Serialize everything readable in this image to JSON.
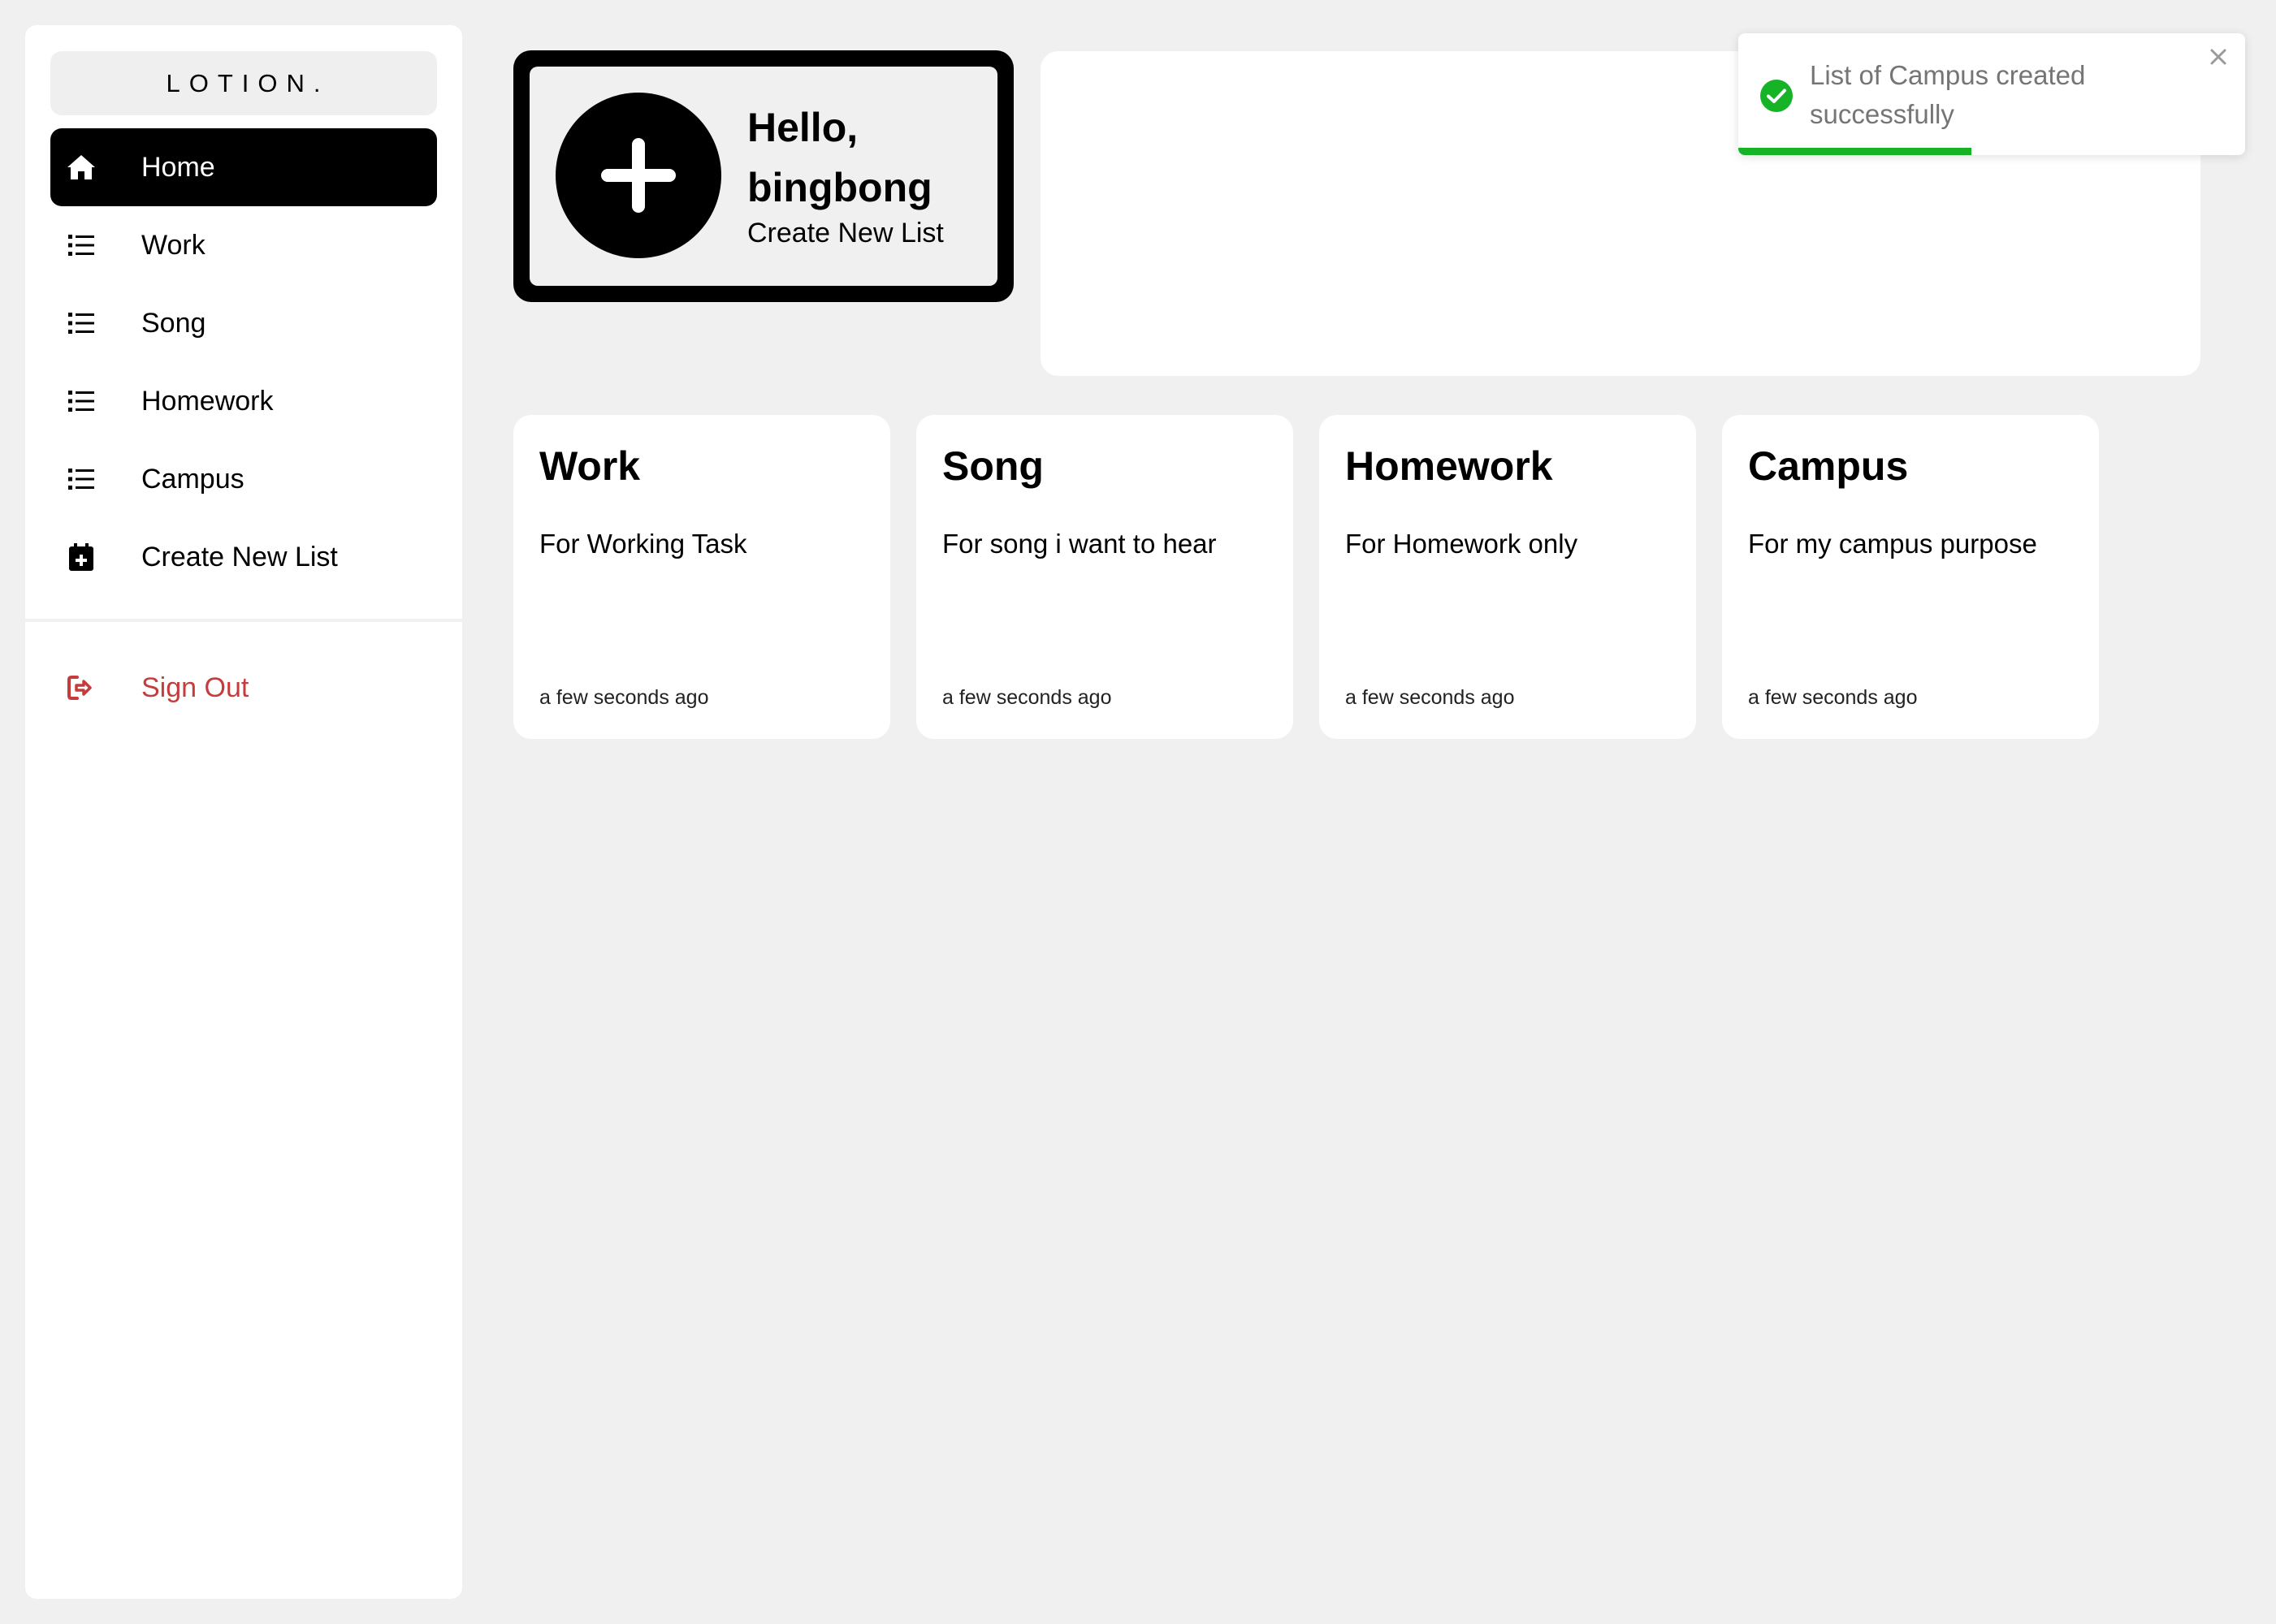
{
  "app": {
    "logo": "LOTION."
  },
  "sidebar": {
    "items": [
      {
        "label": "Home",
        "icon": "home-icon",
        "active": true
      },
      {
        "label": "Work",
        "icon": "list-icon",
        "active": false
      },
      {
        "label": "Song",
        "icon": "list-icon",
        "active": false
      },
      {
        "label": "Homework",
        "icon": "list-icon",
        "active": false
      },
      {
        "label": "Campus",
        "icon": "list-icon",
        "active": false
      },
      {
        "label": "Create New List",
        "icon": "calendar-plus-icon",
        "active": false
      }
    ],
    "signout": {
      "label": "Sign Out",
      "icon": "sign-out-icon",
      "color": "#c43c3c"
    }
  },
  "hero": {
    "title": "Hello, bingbong",
    "subtitle": "Create New List",
    "icon": "plus-circle-icon"
  },
  "cards": [
    {
      "title": "Work",
      "description": "For Working Task",
      "time": "a few seconds ago"
    },
    {
      "title": "Song",
      "description": "For song i want to hear",
      "time": "a few seconds ago"
    },
    {
      "title": "Homework",
      "description": "For Homework only",
      "time": "a few seconds ago"
    },
    {
      "title": "Campus",
      "description": "For my campus purpose",
      "time": "a few seconds ago"
    }
  ],
  "toast": {
    "message": "List of Campus created successfully",
    "icon": "check-circle-icon",
    "progress": 0.46,
    "accent": "#17b326"
  },
  "colors": {
    "background": "#f0f0f0",
    "surface": "#ffffff",
    "primary": "#000000",
    "danger": "#c43c3c",
    "success": "#17b326"
  }
}
